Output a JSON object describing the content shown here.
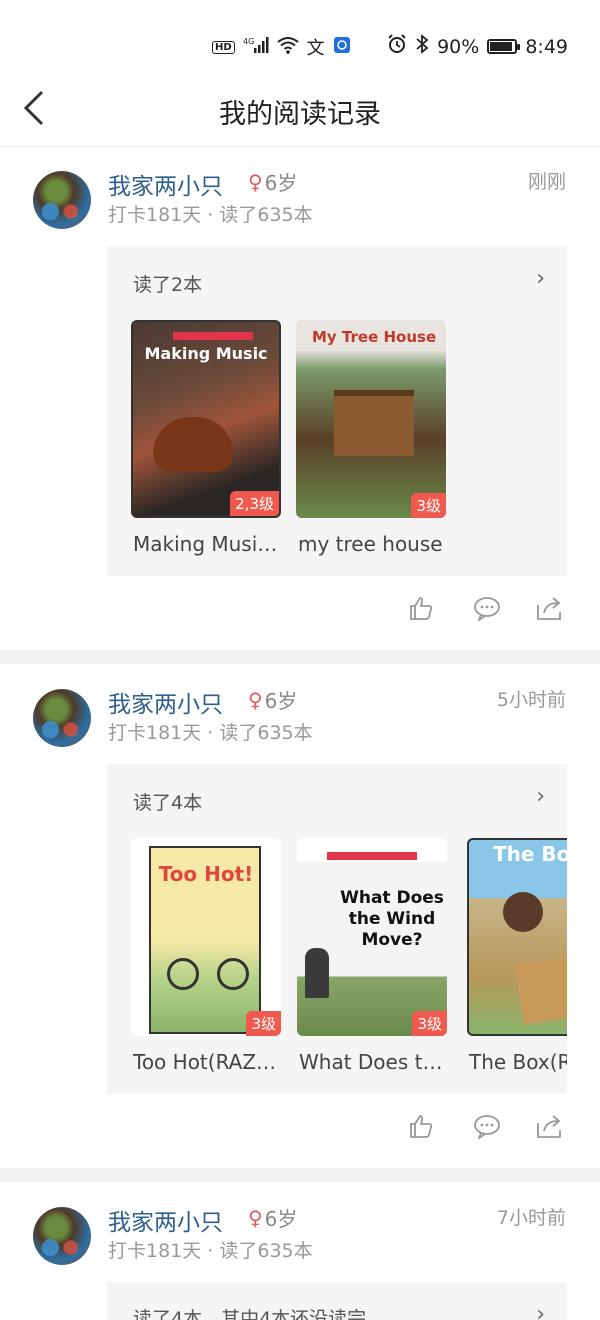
{
  "status_bar": {
    "network": "HD",
    "signal_type": "4G",
    "battery": "90%",
    "battery_level": 0.9,
    "time": "8:49"
  },
  "nav": {
    "title": "我的阅读记录"
  },
  "posts": [
    {
      "username": "我家两小只",
      "age": "6岁",
      "time": "刚刚",
      "stats": "打卡181天 · 读了635本",
      "read_count": "读了2本",
      "books": [
        {
          "title": "Making Music",
          "cover_title": "Making Music",
          "level": "2,3级",
          "name": "Making Musi…"
        },
        {
          "title": "My Tree House",
          "cover_title": "My Tree House",
          "level": "3级",
          "name": "my tree house"
        }
      ]
    },
    {
      "username": "我家两小只",
      "age": "6岁",
      "time": "5小时前",
      "stats": "打卡181天 · 读了635本",
      "read_count": "读了4本",
      "books": [
        {
          "title": "Too Hot!",
          "cover_title": "Too Hot!",
          "level": "3级",
          "name": "Too Hot(RAZ…"
        },
        {
          "title": "What Does the Wind Move?",
          "cover_title": "What Does the Wind Move?",
          "level": "3级",
          "name": "What Does t…"
        },
        {
          "title": "The Box",
          "cover_title": "The Bo",
          "level": "",
          "name": "The Box(R"
        }
      ]
    },
    {
      "username": "我家两小只",
      "age": "6岁",
      "time": "7小时前",
      "stats": "打卡181天 · 读了635本",
      "read_count": "读了4本，其中4本还没读完"
    }
  ],
  "icons": {
    "like": "thumb-up-icon",
    "comment": "comment-icon",
    "share": "share-icon",
    "back": "back-arrow-icon",
    "gender": "female-icon"
  },
  "colors": {
    "username": "#2f5f8f",
    "level_badge": "#f05a4e",
    "panel_bg": "#f5f5f5"
  }
}
